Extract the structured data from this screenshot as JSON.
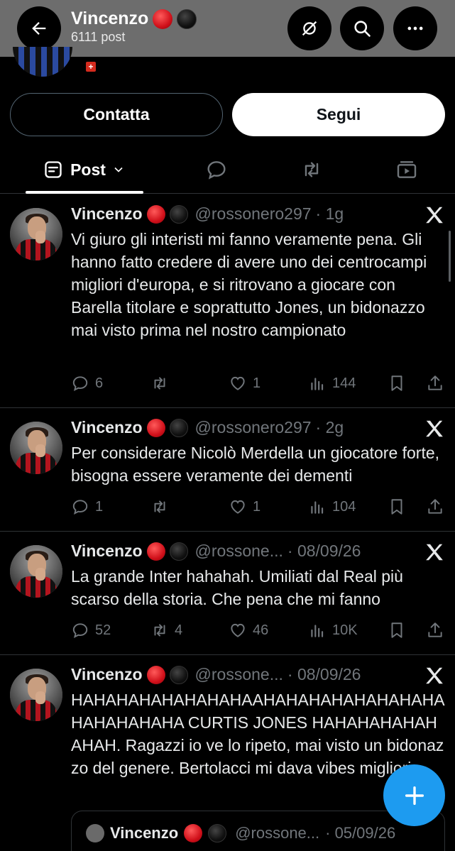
{
  "header": {
    "back_icon": "arrow-left-icon",
    "title": "Vincenzo",
    "subtitle": "6111 post",
    "title_badges": [
      "red-circle",
      "black-circle"
    ],
    "actions": [
      "no-connection-icon",
      "search-icon",
      "more-icon"
    ]
  },
  "profile": {
    "flag": "swiss-flag-icon"
  },
  "buttons": {
    "contact": "Contatta",
    "follow": "Segui"
  },
  "tabs": {
    "active_label": "Post",
    "icons": [
      "posts-icon",
      "replies-icon",
      "reposts-icon",
      "media-icon"
    ]
  },
  "tweets": [
    {
      "name": "Vincenzo",
      "handle": "@rossonero297",
      "time": "· 1g",
      "text": "Vi giuro gli interisti mi fanno veramente pena. Gli hanno fatto credere di avere uno dei centrocampi migliori d'europa, e si ritrovano a giocare con Barella titolare e soprattutto Jones, un bidonazzo mai visto prima nel nostro campionato",
      "replies": "6",
      "reposts": "",
      "likes": "1",
      "views": "144"
    },
    {
      "name": "Vincenzo",
      "handle": "@rossonero297",
      "time": "· 2g",
      "text": "Per considerare Nicolò Merdella un giocatore forte, bisogna essere veramente dei dementi",
      "replies": "1",
      "reposts": "",
      "likes": "1",
      "views": "104"
    },
    {
      "name": "Vincenzo",
      "handle": "@rossone...",
      "time": "· 08/09/26",
      "text": "La grande Inter hahahah. Umiliati dal Real più scarso della storia. Che pena che mi fanno",
      "replies": "52",
      "reposts": "4",
      "likes": "46",
      "views": "10K"
    },
    {
      "name": "Vincenzo",
      "handle": "@rossone...",
      "time": "· 08/09/26",
      "text": "HAHAHAHAHAHAHAHAAHAHAHAHAHAHAHAHAHAHAHAHAHA CURTIS JONES HAHAHAHAHAHAHAH. Ragazzi io ve lo ripeto, mai visto un bidonazzo del genere. Bertolacci mi dava vibes migliori",
      "quote": {
        "name": "Vincenzo",
        "handle": "@rossone...",
        "time": "· 05/09/26"
      }
    }
  ],
  "fab": {
    "icon": "compose-plus-icon"
  },
  "colors": {
    "background": "#000000",
    "header_bg": "#6d6d6d",
    "text": "#e7e9ea",
    "muted": "#71767b",
    "accent": "#1d9bf0",
    "divider": "#2f3336"
  }
}
